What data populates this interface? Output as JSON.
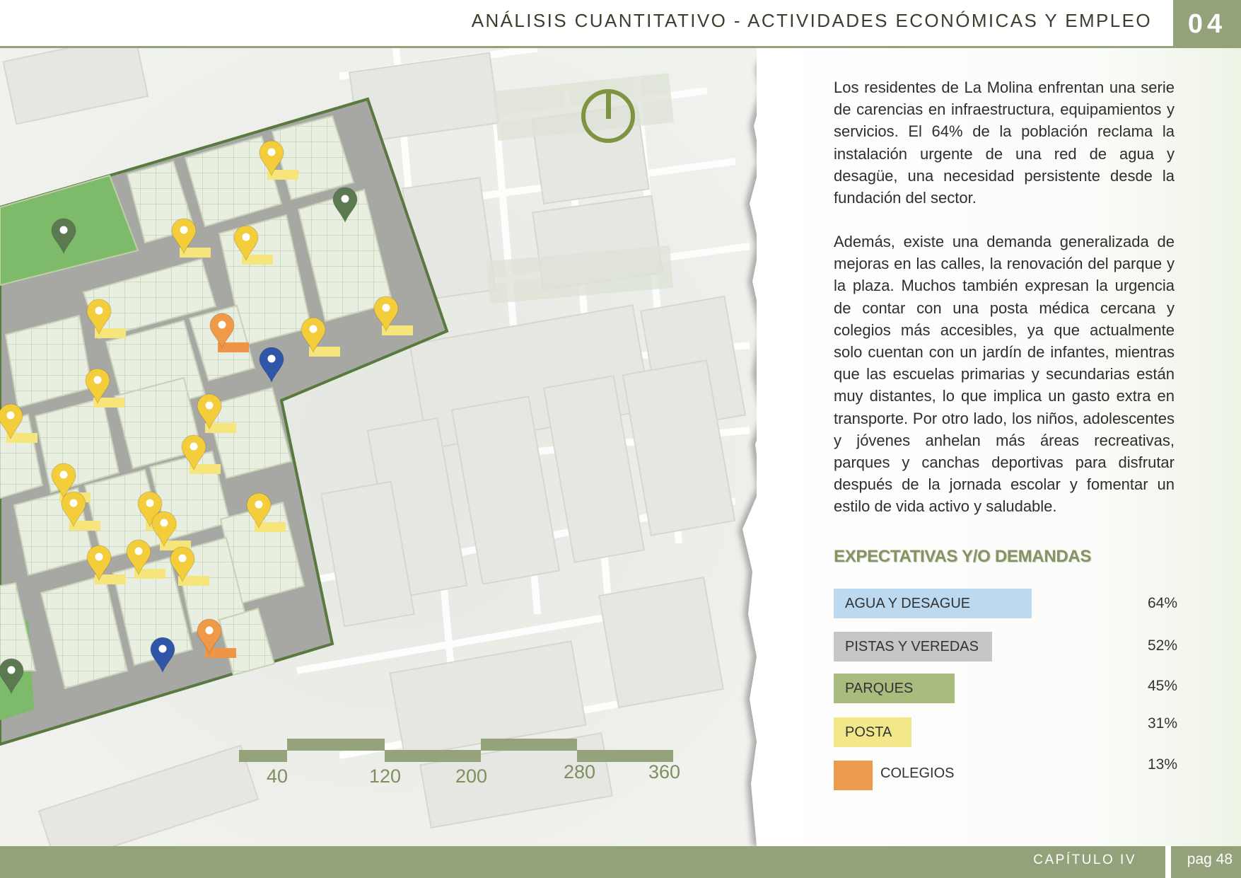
{
  "header": {
    "title": "ANÁLISIS CUANTITATIVO - ACTIVIDADES ECONÓMICAS Y EMPLEO",
    "chapter_number": "04"
  },
  "text": {
    "paragraph_1": "Los residentes de La Molina enfrentan una serie de carencias en infraestructura, equipamientos y servicios. El 64% de la población reclama la instalación urgente de una red de agua y desagüe, una necesidad persistente desde la fundación del sector.",
    "paragraph_2": "Además, existe una demanda generalizada de mejoras en las calles, la renovación del parque y la plaza. Muchos también expresan la urgencia de contar con una posta médica cercana y colegios más accesibles, ya que actualmente solo cuentan con un jardín de infantes, mientras que las escuelas primarias y secundarias están muy distantes, lo que implica un gasto extra en transporte. Por otro lado, los niños, adolescentes y jóvenes anhelan más áreas recreativas, parques y canchas deportivas para disfrutar después de la jornada escolar y fomentar un estilo de vida activo y saludable."
  },
  "demands": {
    "title": "EXPECTATIVAS Y/O DEMANDAS",
    "items": [
      {
        "label": "AGUA Y DESAGUE",
        "percent": "64%",
        "value": 64,
        "color": "#bcd9ef"
      },
      {
        "label": "PISTAS Y VEREDAS",
        "percent": "52%",
        "value": 52,
        "color": "#c6c6c6"
      },
      {
        "label": "PARQUES",
        "percent": "45%",
        "value": 45,
        "color": "#a9bb7d"
      },
      {
        "label": "POSTA",
        "percent": "31%",
        "value": 31,
        "color": "#f2e88a"
      },
      {
        "label": "COLEGIOS",
        "percent": "13%",
        "value": 13,
        "color": "#ee9a4e"
      }
    ]
  },
  "scale": {
    "labels": [
      "40",
      "120",
      "200",
      "280",
      "360"
    ]
  },
  "map": {
    "pin_colors": {
      "yellow": "#f3cd3a",
      "orange": "#ef9a48",
      "blue": "#2f56a8",
      "green": "#5b7a52"
    },
    "compass_icon": "north-arrow-icon"
  },
  "footer": {
    "chapter": "CAPÍTULO IV",
    "page": "pag 48"
  }
}
